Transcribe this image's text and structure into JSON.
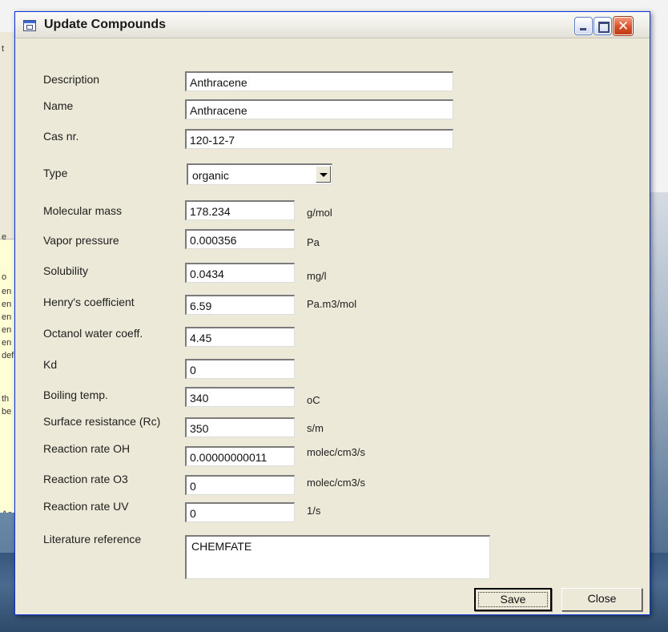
{
  "window": {
    "title": "Update Compounds"
  },
  "background": {
    "fragments": [
      "t",
      "e",
      "o",
      "en",
      "en",
      "en",
      "en",
      "en",
      "def",
      "th",
      "be",
      "Ac"
    ]
  },
  "form": {
    "description": {
      "label": "Description",
      "value": "Anthracene"
    },
    "name": {
      "label": "Name",
      "value": "Anthracene"
    },
    "cas": {
      "label": "Cas nr.",
      "value": "120-12-7"
    },
    "type": {
      "label": "Type",
      "value": "organic"
    },
    "molecular_mass": {
      "label": "Molecular mass",
      "value": "178.234",
      "unit": "g/mol"
    },
    "vapor_pressure": {
      "label": "Vapor pressure",
      "value": "0.000356",
      "unit": "Pa"
    },
    "solubility": {
      "label": "Solubility",
      "value": "0.0434",
      "unit": "mg/l"
    },
    "henry": {
      "label": "Henry's coefficient",
      "value": "6.59",
      "unit": "Pa.m3/mol"
    },
    "octanol": {
      "label": "Octanol water coeff.",
      "value": "4.45"
    },
    "kd": {
      "label": "Kd",
      "value": "0"
    },
    "boiling": {
      "label": "Boiling temp.",
      "value": "340",
      "unit": "oC"
    },
    "surface": {
      "label": "Surface resistance (Rc)",
      "value": "350",
      "unit": "s/m"
    },
    "oh": {
      "label": "Reaction rate OH",
      "value": "0.00000000011",
      "unit": "molec/cm3/s"
    },
    "o3": {
      "label": "Reaction rate O3",
      "value": "0",
      "unit": "molec/cm3/s"
    },
    "uv": {
      "label": "Reaction rate UV",
      "value": "0",
      "unit": "1/s"
    },
    "literature": {
      "label": "Literature reference",
      "value": "CHEMFATE"
    }
  },
  "buttons": {
    "save": "Save",
    "close": "Close"
  },
  "icons": {
    "window": "app-window-icon",
    "dropdown": "chevron-down-icon"
  }
}
